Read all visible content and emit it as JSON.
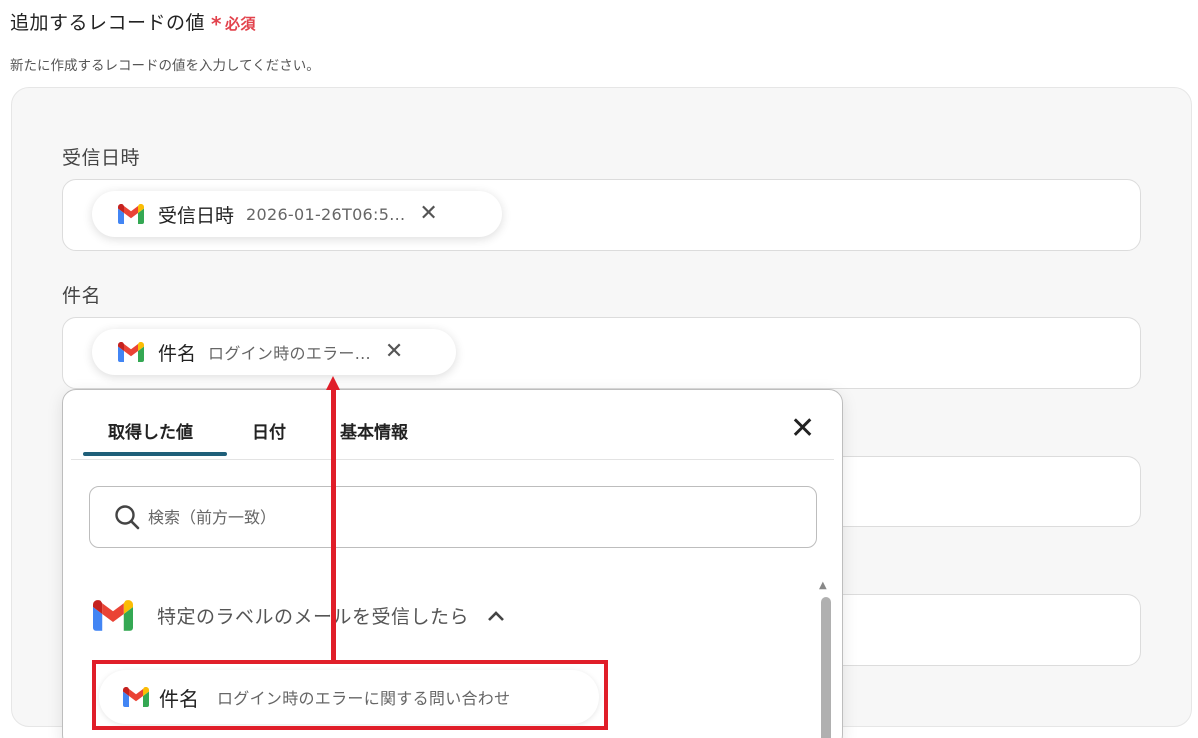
{
  "header": {
    "title": "追加するレコードの値",
    "required_star": "*",
    "required_label": "必須",
    "description": "新たに作成するレコードの値を入力してください。"
  },
  "fields": [
    {
      "label": "受信日時",
      "chip_label": "受信日時",
      "chip_value": "2026-01-26T06:5...",
      "chip_close": "✕"
    },
    {
      "label": "件名",
      "chip_label": "件名",
      "chip_value": "ログイン時のエラー...",
      "chip_close": "✕"
    }
  ],
  "popup": {
    "tabs": [
      "取得した値",
      "日付",
      "基本情報"
    ],
    "active_tab": "取得した値",
    "close_icon": "✕",
    "search_placeholder": "検索（前方一致）",
    "scroll_up": "▲",
    "group_title": "特定のラベルのメールを受信したら",
    "item": {
      "label": "件名",
      "value": "ログイン時のエラーに関する問い合わせ"
    }
  },
  "icons": {
    "gmail": "gmail-icon",
    "search": "search-icon",
    "chevron": "chevron-up-icon",
    "close": "close-icon"
  },
  "colors": {
    "required": "#e2424c",
    "tab_indicator": "#1f5f79",
    "annotation": "#e01e29"
  }
}
